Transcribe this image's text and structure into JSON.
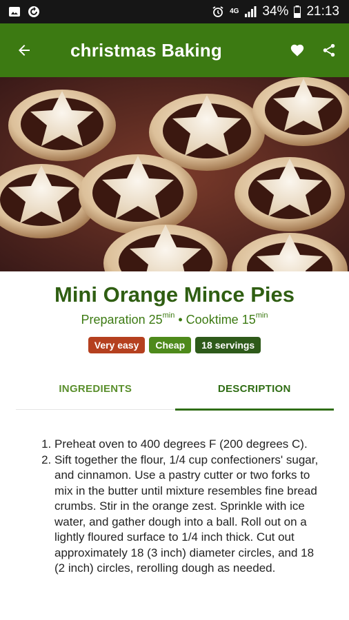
{
  "statusbar": {
    "battery": "34%",
    "time": "21:13",
    "network": "4G"
  },
  "appbar": {
    "title": "christmas Baking"
  },
  "recipe": {
    "title": "Mini Orange Mince Pies",
    "prep_label": "Preparation 25",
    "prep_unit": "min",
    "separator": " • ",
    "cook_label": "Cooktime 15",
    "cook_unit": "min"
  },
  "badges": [
    {
      "label": "Very easy",
      "color": "#b5401f"
    },
    {
      "label": "Cheap",
      "color": "#4e8a1b"
    },
    {
      "label": "18 servings",
      "color": "#2e5a1a"
    }
  ],
  "tabs": [
    {
      "label": "INGREDIENTS"
    },
    {
      "label": "DESCRIPTION"
    }
  ],
  "description": {
    "steps": [
      "Preheat oven to 400 degrees F (200 degrees C).",
      "Sift together the flour, 1/4 cup confectioners' sugar, and cinnamon. Use a pastry cutter or two forks to mix in the butter until mixture resembles fine bread crumbs. Stir in the orange zest. Sprinkle with ice water, and gather dough into a ball. Roll out on a lightly floured surface to 1/4 inch thick. Cut out approximately 18 (3 inch) diameter circles, and 18 (2 inch) circles, rerolling dough as needed."
    ]
  },
  "colors": {
    "appbar": "#3c7a12",
    "statusbar": "#161616",
    "accent": "#2f6d14"
  }
}
